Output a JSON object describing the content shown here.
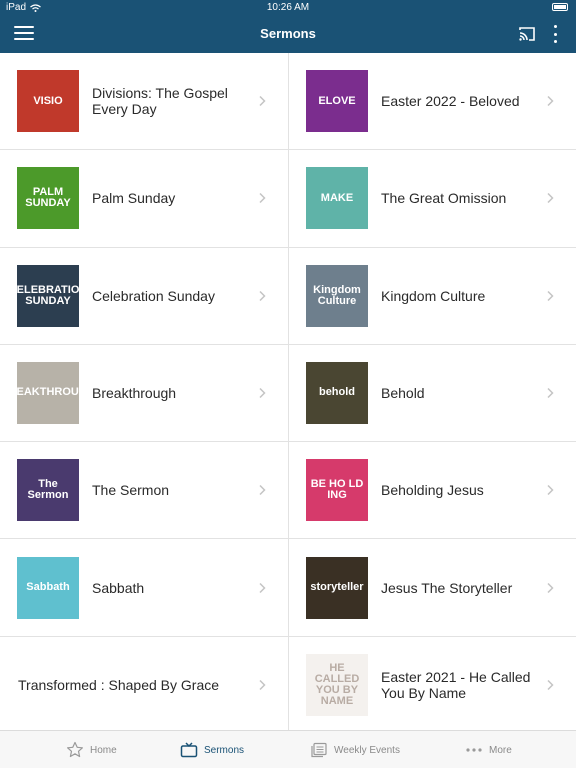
{
  "status": {
    "device": "iPad",
    "time": "10:26 AM"
  },
  "nav": {
    "title": "Sermons"
  },
  "sermons": [
    {
      "label": "Divisions: The Gospel Every Day",
      "thumb_text": "VISIO",
      "thumb_color": "#c0392b"
    },
    {
      "label": "Easter 2022 - Beloved",
      "thumb_text": "ELOVE",
      "thumb_color": "#7b2d8e"
    },
    {
      "label": "Palm Sunday",
      "thumb_text": "PALM SUNDAY",
      "thumb_color": "#4c9a2a"
    },
    {
      "label": "The Great Omission",
      "thumb_text": "MAKE",
      "thumb_color": "#5fb3a8"
    },
    {
      "label": "Celebration Sunday",
      "thumb_text": "CELEBRATION SUNDAY",
      "thumb_color": "#2c3e50"
    },
    {
      "label": "Kingdom Culture",
      "thumb_text": "Kingdom Culture",
      "thumb_color": "#6e7f8d"
    },
    {
      "label": "Breakthrough",
      "thumb_text": "BREAKTHROUGH",
      "thumb_color": "#b7b2a8"
    },
    {
      "label": "Behold",
      "thumb_text": "behold",
      "thumb_color": "#4a4632"
    },
    {
      "label": "The Sermon",
      "thumb_text": "The Sermon",
      "thumb_color": "#4a3a6e"
    },
    {
      "label": "Beholding Jesus",
      "thumb_text": "BE HO LD ING",
      "thumb_color": "#d63a6b"
    },
    {
      "label": "Sabbath",
      "thumb_text": "Sabbath",
      "thumb_color": "#5fc0cf"
    },
    {
      "label": "Jesus The Storyteller",
      "thumb_text": "storyteller",
      "thumb_color": "#3a3024"
    },
    {
      "label": "Transformed : Shaped By Grace",
      "thumb_text": "",
      "thumb_color": ""
    },
    {
      "label": "Easter 2021 - He Called You By Name",
      "thumb_text": "HE CALLED YOU BY NAME",
      "thumb_color": "#f4f1ee"
    }
  ],
  "tabs": [
    {
      "label": "Home",
      "icon": "star-icon"
    },
    {
      "label": "Sermons",
      "icon": "tv-icon"
    },
    {
      "label": "Weekly Events",
      "icon": "list-icon"
    },
    {
      "label": "More",
      "icon": "dots-icon"
    }
  ],
  "colors": {
    "primary": "#1a5275",
    "divider": "#e2e2e2",
    "tab_inactive": "#8a8a8a"
  }
}
